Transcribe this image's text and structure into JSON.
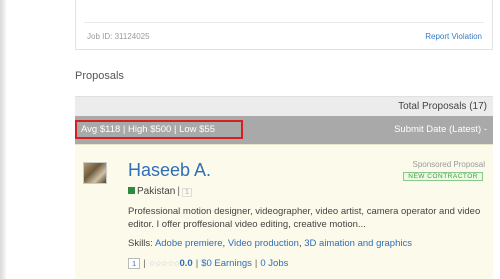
{
  "job": {
    "job_id_text": "Job ID: 31124025",
    "report_label": "Report Violation"
  },
  "section": {
    "title": "Proposals"
  },
  "proposals_header": {
    "total_text": "Total Proposals (17)",
    "stats_text": "Avg $118 | High $500 | Low $55",
    "sort_text": "Submit Date (Latest) -"
  },
  "proposal": {
    "name": "Haseeb A.",
    "sponsored_label": "Sponsored Proposal",
    "badge_label": "NEW CONTRACTOR",
    "country": "Pakistan",
    "location_level": "1",
    "description": "Professional motion designer, videographer, video artist, camera operator and video editor. I offer proffesional video editing, creative motion...",
    "skills_label": "Skills:",
    "skills": [
      "Adobe premiere",
      "Video production",
      "3D aimation and graphics"
    ],
    "level": "1",
    "stars_text": "☆☆☆☆☆",
    "rating": "0.0",
    "earnings": "$0 Earnings",
    "jobs": "0 Jobs"
  }
}
